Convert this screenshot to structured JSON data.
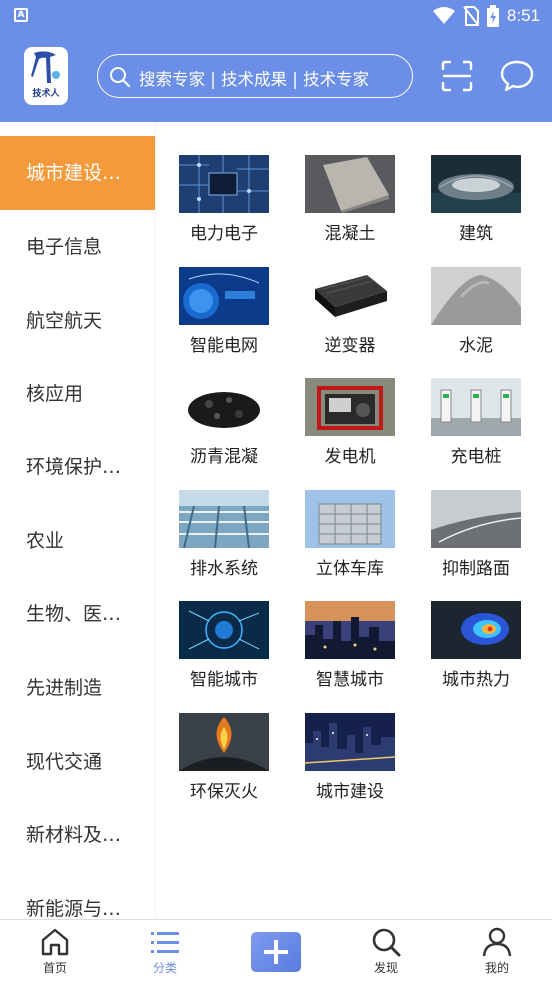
{
  "status_bar": {
    "time": "8:51",
    "left_badge": "A"
  },
  "header": {
    "logo_text": "技术人",
    "search_placeholder": "搜索专家 | 技术成果 | 技术专家"
  },
  "colors": {
    "primary": "#6b8fe6",
    "active_category": "#f39a3d"
  },
  "sidebar": {
    "items": [
      {
        "label": "城市建设…",
        "active": true
      },
      {
        "label": "电子信息"
      },
      {
        "label": "航空航天"
      },
      {
        "label": "核应用"
      },
      {
        "label": "环境保护…"
      },
      {
        "label": "农业"
      },
      {
        "label": "生物、医…"
      },
      {
        "label": "先进制造"
      },
      {
        "label": "现代交通"
      },
      {
        "label": "新材料及…"
      },
      {
        "label": "新能源与…"
      }
    ]
  },
  "grid": {
    "items": [
      {
        "label": "电力电子",
        "icon": "circuit-board-image"
      },
      {
        "label": "混凝土",
        "icon": "concrete-slab-image"
      },
      {
        "label": "建筑",
        "icon": "stadium-image"
      },
      {
        "label": "智能电网",
        "icon": "smart-grid-image"
      },
      {
        "label": "逆变器",
        "icon": "inverter-image"
      },
      {
        "label": "水泥",
        "icon": "cement-powder-image"
      },
      {
        "label": "沥青混凝",
        "icon": "asphalt-image"
      },
      {
        "label": "发电机",
        "icon": "generator-image"
      },
      {
        "label": "充电桩",
        "icon": "charging-station-image"
      },
      {
        "label": "排水系统",
        "icon": "drainage-image"
      },
      {
        "label": "立体车库",
        "icon": "parking-garage-image"
      },
      {
        "label": "抑制路面",
        "icon": "road-image"
      },
      {
        "label": "智能城市",
        "icon": "ai-city-image"
      },
      {
        "label": "智慧城市",
        "icon": "city-night-image"
      },
      {
        "label": "城市热力",
        "icon": "heatmap-image"
      },
      {
        "label": "环保灭火",
        "icon": "firefighting-image"
      },
      {
        "label": "城市建设",
        "icon": "city-skyline-image"
      }
    ]
  },
  "bottom_nav": {
    "items": [
      {
        "label": "首页",
        "icon": "home-icon"
      },
      {
        "label": "分类",
        "icon": "list-icon",
        "active": true
      },
      {
        "label": "",
        "icon": "add-icon"
      },
      {
        "label": "发现",
        "icon": "discover-search-icon"
      },
      {
        "label": "我的",
        "icon": "user-icon"
      }
    ]
  }
}
